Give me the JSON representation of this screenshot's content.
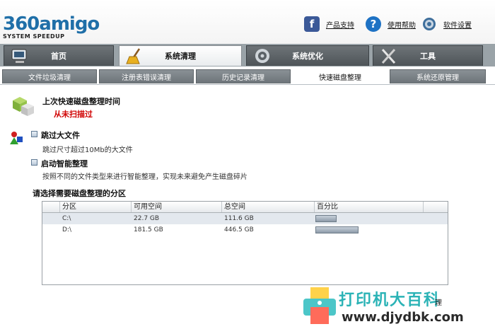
{
  "app": {
    "logo_main": "360amigo",
    "logo_sub": "SYSTEM SPEEDUP",
    "brand_color": "#1f6fa8"
  },
  "top_links": {
    "support": "产品支持",
    "help": "使用帮助",
    "settings": "软件设置"
  },
  "main_tabs": [
    {
      "label": "首页",
      "icon": "computer-icon",
      "active": false
    },
    {
      "label": "系统清理",
      "icon": "broom-icon",
      "active": true
    },
    {
      "label": "系统优化",
      "icon": "gear-icon",
      "active": false
    },
    {
      "label": "工具",
      "icon": "tools-icon",
      "active": false
    }
  ],
  "sub_tabs": [
    {
      "label": "文件垃圾清理",
      "active": false
    },
    {
      "label": "注册表错误清理",
      "active": false
    },
    {
      "label": "历史记录清理",
      "active": false
    },
    {
      "label": "快速磁盘整理",
      "active": true
    },
    {
      "label": "系统还原管理",
      "active": false
    }
  ],
  "defrag": {
    "last_title": "上次快速磁盘整理时间",
    "last_value": "从未扫描过",
    "skip_large": {
      "label": "跳过大文件",
      "desc": "跳过尺寸超过10Mb的大文件",
      "checked": false
    },
    "smart": {
      "label": "启动智能整理",
      "desc": "按照不同的文件类型来进行智能整理，实现未来避免产生磁盘碎片",
      "checked": false
    },
    "partition_title": "请选择需要磁盘整理的分区"
  },
  "table": {
    "columns": [
      "分区",
      "可用空间",
      "总空间",
      "百分比"
    ],
    "rows": [
      {
        "drive": "C:\\",
        "free": "22.7 GB",
        "total": "111.6 GB",
        "percent": 0.2
      },
      {
        "drive": "D:\\",
        "free": "181.5 GB",
        "total": "446.5 GB",
        "percent": 0.41
      }
    ]
  },
  "watermark": {
    "text": "打印机大百科",
    "url": "www.djydbk.com",
    "partial": "理"
  }
}
